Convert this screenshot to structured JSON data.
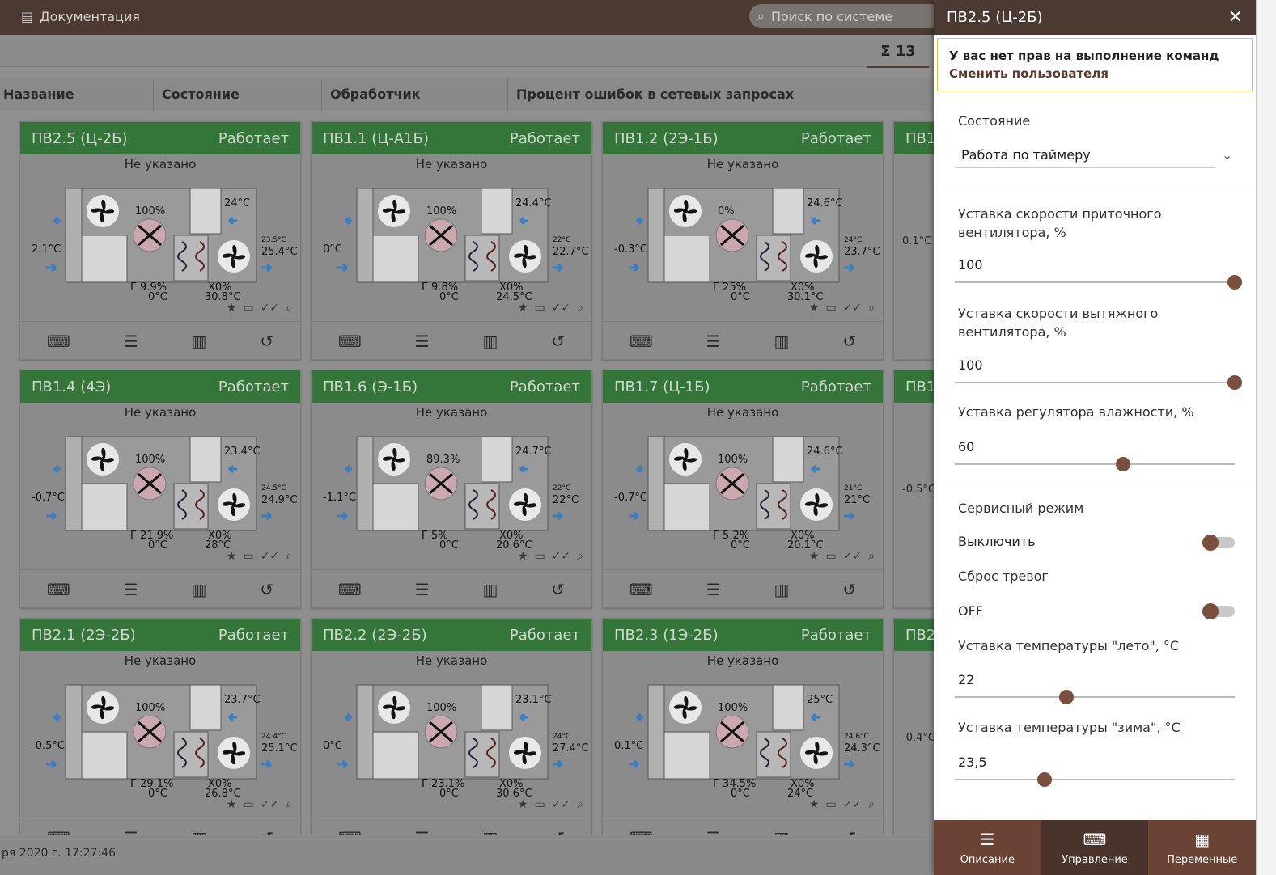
{
  "topbar": {
    "docs": "Документация",
    "search_placeholder": "Поиск по системе"
  },
  "count": "Σ 13",
  "columns": [
    "Название",
    "Состояние",
    "Обработчик",
    "Процент ошибок в сетевых запросах"
  ],
  "status_line": "ря 2020 г. 17:27:46",
  "cards": [
    {
      "name": "ПВ2.5 (Ц-2Б)",
      "state": "Работает",
      "sub": "Не указано",
      "damper": "100%",
      "t_in": "2.1°C",
      "t_out": "24°C",
      "t_s_small": "23.5°C",
      "t_s": "25.4°C",
      "g": "Г",
      "g_val": "9.9%",
      "t_coil": "0°C",
      "x": "X0%",
      "t_ret": "30.8°C"
    },
    {
      "name": "ПВ1.1 (Ц-А1Б)",
      "state": "Работает",
      "sub": "Не указано",
      "damper": "100%",
      "t_in": "0°C",
      "t_out": "24.4°C",
      "t_s_small": "22°C",
      "t_s": "22.7°C",
      "g": "Г",
      "g_val": "9.8%",
      "t_coil": "0°C",
      "x": "X0%",
      "t_ret": "24.5°C"
    },
    {
      "name": "ПВ1.2 (2Э-1Б)",
      "state": "Работает",
      "sub": "Не указано",
      "damper": "0%",
      "t_in": "-0.3°C",
      "t_out": "24.6°C",
      "t_s_small": "24°C",
      "t_s": "23.7°C",
      "g": "Г",
      "g_val": "25%",
      "t_coil": "0°C",
      "x": "X0%",
      "t_ret": "30.1°C"
    },
    {
      "name": "ПВ1.4 (4Э)",
      "state": "Работает",
      "sub": "Не указано",
      "damper": "100%",
      "t_in": "-0.7°C",
      "t_out": "23.4°C",
      "t_s_small": "24.5°C",
      "t_s": "24.9°C",
      "g": "Г",
      "g_val": "21.9%",
      "t_coil": "0°C",
      "x": "X0%",
      "t_ret": "28°C"
    },
    {
      "name": "ПВ1.6 (Э-1Б)",
      "state": "Работает",
      "sub": "Не указано",
      "damper": "89.3%",
      "t_in": "-1.1°C",
      "t_out": "24.7°C",
      "t_s_small": "22°C",
      "t_s": "22°C",
      "g": "Г",
      "g_val": "5%",
      "t_coil": "0°C",
      "x": "X0%",
      "t_ret": "20.6°C"
    },
    {
      "name": "ПВ1.7 (Ц-1Б)",
      "state": "Работает",
      "sub": "Не указано",
      "damper": "100%",
      "t_in": "-0.7°C",
      "t_out": "24.6°C",
      "t_s_small": "21°C",
      "t_s": "21°C",
      "g": "Г",
      "g_val": "5.2%",
      "t_coil": "0°C",
      "x": "X0%",
      "t_ret": "20.1°C"
    },
    {
      "name": "ПВ2.1 (2Э-2Б)",
      "state": "Работает",
      "sub": "Не указано",
      "damper": "100%",
      "t_in": "-0.5°C",
      "t_out": "23.7°C",
      "t_s_small": "24.4°C",
      "t_s": "25.1°C",
      "g": "Г",
      "g_val": "29.1%",
      "t_coil": "0°C",
      "x": "X0%",
      "t_ret": "26.8°C"
    },
    {
      "name": "ПВ2.2 (2Э-2Б)",
      "state": "Работает",
      "sub": "Не указано",
      "damper": "100%",
      "t_in": "0°C",
      "t_out": "23.1°C",
      "t_s_small": "24°C",
      "t_s": "27.4°C",
      "g": "Г",
      "g_val": "23.1%",
      "t_coil": "0°C",
      "x": "X0%",
      "t_ret": "30.6°C"
    },
    {
      "name": "ПВ2.3 (1Э-2Б)",
      "state": "Работает",
      "sub": "Не указано",
      "damper": "100%",
      "t_in": "0.1°C",
      "t_out": "25°C",
      "t_s_small": "24.6°C",
      "t_s": "24.3°C",
      "g": "Г",
      "g_val": "34.5%",
      "t_coil": "0°C",
      "x": "X0%",
      "t_ret": "24°C"
    }
  ],
  "partial_cards": [
    {
      "name": "ПВ1",
      "t_in": "0.1°C"
    },
    {
      "name": "ПВ1",
      "t_in": "-0.5°C"
    },
    {
      "name": "ПВ2",
      "t_in": "-0.4°C"
    }
  ],
  "panel": {
    "title": "ПВ2.5 (Ц-2Б)",
    "warn": "У вас нет прав на выполнение команд",
    "switch_user": "Сменить пользователя",
    "state_label": "Состояние",
    "state_value": "Работа по таймеру",
    "supply_label": "Уставка скорости приточного вентилятора, %",
    "supply_value": "100",
    "exhaust_label": "Уставка скорости вытяжного вентилятора, %",
    "exhaust_value": "100",
    "hum_label": "Уставка регулятора влажности, %",
    "hum_value": "60",
    "service_label": "Сервисный режим",
    "service_value": "Выключить",
    "reset_label": "Сброс тревог",
    "reset_value": "OFF",
    "summer_label": "Уставка температуры \"лето\", °C",
    "summer_value": "22",
    "winter_label": "Уставка температуры \"зима\", °C",
    "winter_value": "23,5",
    "tabs": [
      "Описание",
      "Управление",
      "Переменные"
    ]
  },
  "sliders": {
    "supply": 100,
    "exhaust": 100,
    "hum": 60,
    "summer": 0.4,
    "winter": 0.32
  }
}
